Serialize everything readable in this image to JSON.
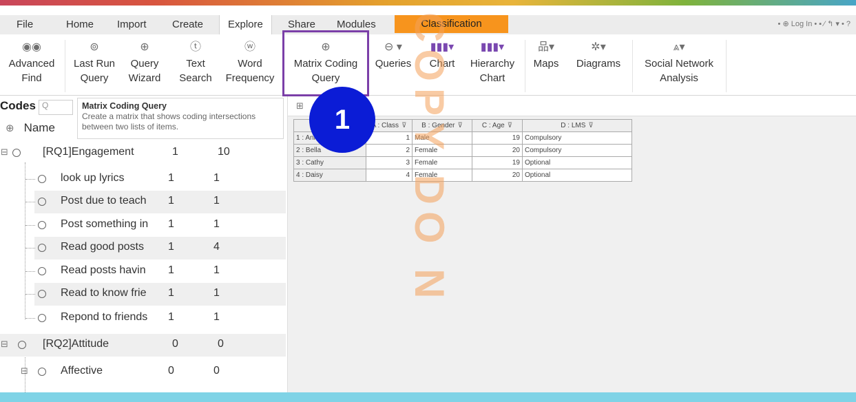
{
  "menu": {
    "tabs": [
      "File",
      "Home",
      "Import",
      "Create",
      "Explore",
      "Share",
      "Modules"
    ],
    "active_tab": "Explore",
    "classification": "Classification",
    "quick_access": "• ⊕ Log In  • ▪ ⁄ ↰ ▾ • ?"
  },
  "ribbon": {
    "advanced_find": [
      "Advanced",
      "Find"
    ],
    "last_run_query": [
      "Last Run",
      "Query"
    ],
    "query_wizard": [
      "Query",
      "Wizard"
    ],
    "text_search": [
      "Text",
      "Search"
    ],
    "word_frequency": [
      "Word",
      "Frequency"
    ],
    "matrix_coding_query": [
      "Matrix Coding",
      "Query"
    ],
    "queries": [
      "Queries",
      ""
    ],
    "chart": [
      "Chart",
      ""
    ],
    "hierarchy_chart": [
      "Hierarchy",
      "Chart"
    ],
    "maps": [
      "Maps",
      ""
    ],
    "diagrams": [
      "Diagrams",
      ""
    ],
    "social_network_analysis": [
      "Social Network",
      "Analysis"
    ]
  },
  "tooltip": {
    "title": "Matrix Coding Query",
    "body": "Create a matrix that shows coding intersections between two lists of items."
  },
  "codes": {
    "header": "Codes",
    "search_placeholder": "Q",
    "name_col": "Name",
    "rows": [
      {
        "label": "[RQ1]Engagement",
        "files": "1",
        "refs": "10"
      },
      {
        "label": "look up lyrics",
        "files": "1",
        "refs": "1"
      },
      {
        "label": "Post due to teach",
        "files": "1",
        "refs": "1"
      },
      {
        "label": "Post something in",
        "files": "1",
        "refs": "1"
      },
      {
        "label": "Read good posts",
        "files": "1",
        "refs": "4"
      },
      {
        "label": "Read posts havin",
        "files": "1",
        "refs": "1"
      },
      {
        "label": "Read to know frie",
        "files": "1",
        "refs": "1"
      },
      {
        "label": "Repond to friends",
        "files": "1",
        "refs": "1"
      },
      {
        "label": "[RQ2]Attitude",
        "files": "0",
        "refs": "0"
      },
      {
        "label": "Affective",
        "files": "0",
        "refs": "0"
      }
    ]
  },
  "matrix": {
    "headers": [
      "A : Class",
      "B : Gender",
      "C : Age",
      "D : LMS"
    ],
    "rows": [
      {
        "name": "1 : Anne",
        "class": "1",
        "gender": "Male",
        "age": "19",
        "lms": "Compulsory"
      },
      {
        "name": "2 : Bella",
        "class": "2",
        "gender": "Female",
        "age": "20",
        "lms": "Compulsory"
      },
      {
        "name": "3 : Cathy",
        "class": "3",
        "gender": "Female",
        "age": "19",
        "lms": "Optional"
      },
      {
        "name": "4 : Daisy",
        "class": "4",
        "gender": "Female",
        "age": "20",
        "lms": "Optional"
      }
    ]
  },
  "overlay": {
    "step_number": "1",
    "watermark": "COPY DO N",
    "badge_color": "#0b1cd6",
    "highlight_color": "#7b3fa8",
    "watermark_color": "#f4a05a"
  }
}
